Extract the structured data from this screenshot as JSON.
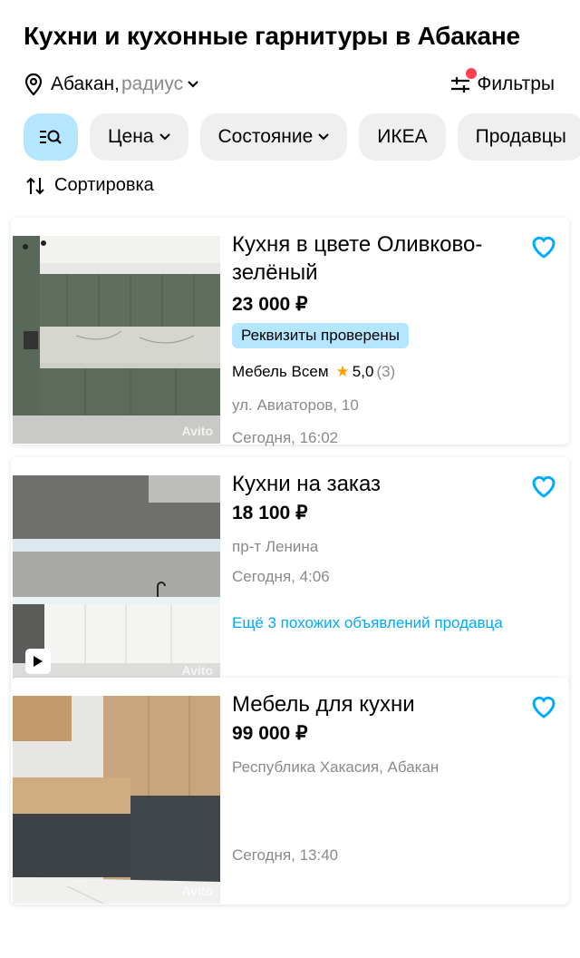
{
  "header": {
    "title": "Кухни и кухонные гарнитуры в Абакане"
  },
  "location": {
    "city": "Абакан,",
    "radius": "радиус",
    "pin_icon": "location-pin-icon"
  },
  "filters": {
    "label": "Фильтры",
    "icon": "sliders-icon",
    "accent": "#ff4053"
  },
  "chips": [
    {
      "label": "",
      "icon": "filter-search-icon",
      "active": true
    },
    {
      "label": "Цена",
      "has_dropdown": true
    },
    {
      "label": "Состояние",
      "has_dropdown": true
    },
    {
      "label": "ИКЕА",
      "has_dropdown": false
    },
    {
      "label": "Продавцы",
      "has_dropdown": false
    }
  ],
  "sort": {
    "label": "Сортировка",
    "icon": "sort-arrows-icon"
  },
  "listings": [
    {
      "title": "Кухня в цвете Оливково-зелёный",
      "price": "23 000 ₽",
      "badge": "Реквизиты проверены",
      "seller": "Мебель Всем",
      "rating": "5,0",
      "reviews": "(3)",
      "address": "ул. Авиаторов, 10",
      "date": "Сегодня, 16:02",
      "watermark": "Avito"
    },
    {
      "title": "Кухни на заказ",
      "price": "18 100 ₽",
      "address": "пр-т Ленина",
      "date": "Сегодня, 4:06",
      "more_link": "Ещё 3 похожих объявлений продавца",
      "watermark": "Avito",
      "has_video": true
    },
    {
      "title": "Мебель для кухни",
      "price": "99 000 ₽",
      "address": "Республика Хакасия, Абакан",
      "date": "Сегодня, 13:40",
      "watermark": "Avito"
    }
  ],
  "colors": {
    "chip_bg": "#efefef",
    "chip_active": "#b4e6ff",
    "accent_blue": "#00aaff",
    "muted": "#8a8a8a",
    "star": "#ffa100"
  }
}
